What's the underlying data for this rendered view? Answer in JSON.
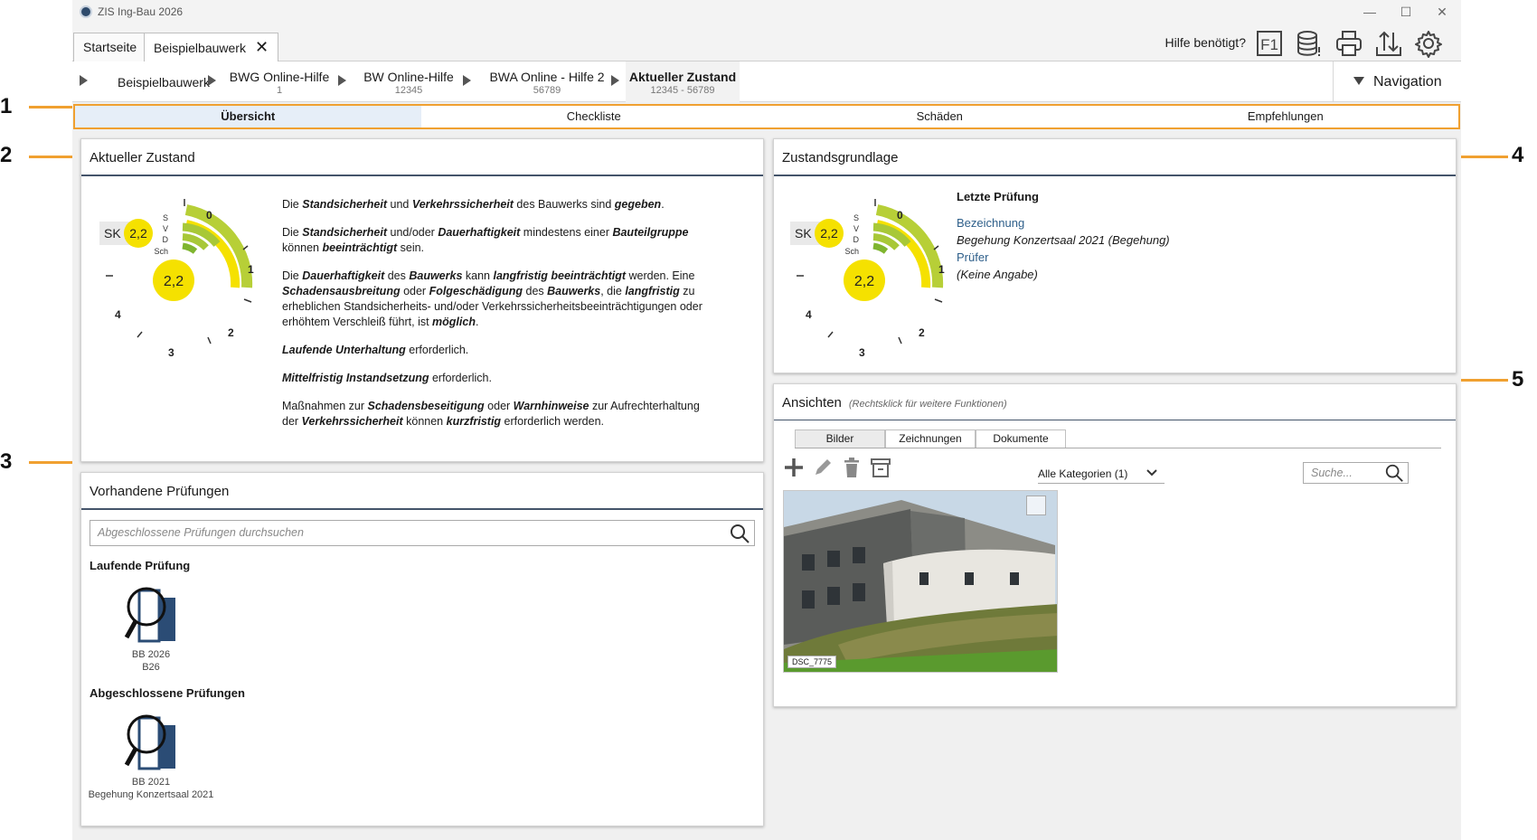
{
  "window": {
    "title": "ZIS Ing-Bau 2026"
  },
  "tabs": [
    {
      "label": "Startseite"
    },
    {
      "label": "Beispielbauwerk",
      "close": "✕"
    }
  ],
  "toolbar": {
    "help_label": "Hilfe benötigt?",
    "f1_label": "F1"
  },
  "breadcrumb": [
    {
      "label": "Beispielbauwerk",
      "sub": ""
    },
    {
      "label": "BWG Online-Hilfe",
      "sub": "1"
    },
    {
      "label": "BW Online-Hilfe",
      "sub": "12345"
    },
    {
      "label": "BWA Online - Hilfe 2",
      "sub": "56789"
    },
    {
      "label": "Aktueller Zustand",
      "sub": "12345 - 56789"
    }
  ],
  "navigation_label": "Navigation",
  "section_tabs": [
    "Übersicht",
    "Checkliste",
    "Schäden",
    "Empfehlungen"
  ],
  "aktueller_zustand": {
    "title": "Aktueller Zustand",
    "sk_label": "SK",
    "sk_value": "2,2",
    "center_value": "2,2",
    "arc_labels": [
      "S",
      "V",
      "D",
      "Sch"
    ],
    "scale": [
      "0",
      "1",
      "2",
      "3",
      "4"
    ],
    "paragraphs": [
      "Die <b><i>Standsicherheit</i></b> und <b><i>Verkehrssicherheit</i></b> des Bauwerks sind <b><i>gegeben</i></b>.",
      "Die <b><i>Standsicherheit</i></b> und/oder <b><i>Dauerhaftigkeit</i></b> mindestens einer <b><i>Bauteilgruppe</i></b> können <b><i>beeinträchtigt</i></b> sein.",
      "Die <b><i>Dauerhaftigkeit</i></b> des <b><i>Bauwerks</i></b> kann <b><i>langfristig beeinträchtigt</i></b> werden. Eine <b><i>Schadensausbreitung</i></b> oder <b><i>Folgeschädigung</i></b> des <b><i>Bauwerks</i></b>, die <b><i>langfristig</i></b> zu erheblichen Standsicherheits- und/oder Verkehrssicherheitsbeeinträchtigungen oder erhöhtem Verschleiß führt, ist <b><i>möglich</i></b>.",
      "<b><i>Laufende Unterhaltung</i></b> erforderlich.",
      "<b><i>Mittelfristig Instandsetzung</i></b> erforderlich.",
      "Maßnahmen zur <b><i>Schadensbeseitigung</i></b> oder <b><i>Warnhinweise</i></b> zur Aufrechterhaltung der <b><i>Verkehrssicherheit</i></b> können <b><i>kurzfristig</i></b> erforderlich werden."
    ]
  },
  "pruefungen": {
    "title": "Vorhandene Prüfungen",
    "search_placeholder": "Abgeschlossene Prüfungen durchsuchen",
    "laufende_heading": "Laufende Prüfung",
    "laufende": {
      "line1": "BB 2026",
      "line2": "B26"
    },
    "abgeschlossen_heading": "Abgeschlossene Prüfungen",
    "abgeschlossen": {
      "line1": "BB 2021",
      "line2": "Begehung Konzertsaal 2021"
    }
  },
  "zustandsgrundlage": {
    "title": "Zustandsgrundlage",
    "sk_label": "SK",
    "sk_value": "2,2",
    "center_value": "2,2",
    "heading": "Letzte Prüfung",
    "bezeichnung_label": "Bezeichnung",
    "bezeichnung_value": "Begehung Konzertsaal 2021 (Begehung)",
    "pruefer_label": "Prüfer",
    "pruefer_value": "(Keine Angabe)"
  },
  "ansichten": {
    "title": "Ansichten",
    "subtitle": "(Rechtsklick für weitere Funktionen)",
    "tabs": [
      "Bilder",
      "Zeichnungen",
      "Dokumente"
    ],
    "category_filter": "Alle Kategorien (1)",
    "search_placeholder": "Suche...",
    "photo_label": "DSC_7775"
  },
  "annotations": [
    "1",
    "2",
    "3",
    "4",
    "5"
  ],
  "colors": {
    "accent_orange": "#f0a030",
    "gauge_yellow": "#f5e100",
    "gauge_green": "#a8c837",
    "title_rule": "#44546a"
  }
}
